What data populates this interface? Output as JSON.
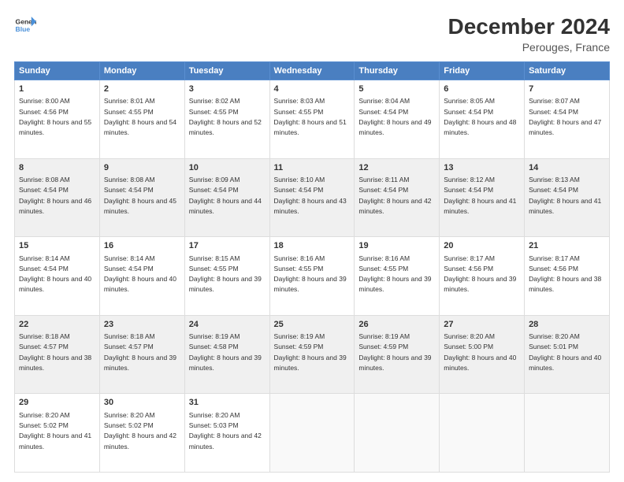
{
  "logo": {
    "line1": "General",
    "line2": "Blue"
  },
  "title": "December 2024",
  "subtitle": "Perouges, France",
  "headers": [
    "Sunday",
    "Monday",
    "Tuesday",
    "Wednesday",
    "Thursday",
    "Friday",
    "Saturday"
  ],
  "weeks": [
    [
      {
        "day": "1",
        "sunrise": "Sunrise: 8:00 AM",
        "sunset": "Sunset: 4:56 PM",
        "daylight": "Daylight: 8 hours and 55 minutes."
      },
      {
        "day": "2",
        "sunrise": "Sunrise: 8:01 AM",
        "sunset": "Sunset: 4:55 PM",
        "daylight": "Daylight: 8 hours and 54 minutes."
      },
      {
        "day": "3",
        "sunrise": "Sunrise: 8:02 AM",
        "sunset": "Sunset: 4:55 PM",
        "daylight": "Daylight: 8 hours and 52 minutes."
      },
      {
        "day": "4",
        "sunrise": "Sunrise: 8:03 AM",
        "sunset": "Sunset: 4:55 PM",
        "daylight": "Daylight: 8 hours and 51 minutes."
      },
      {
        "day": "5",
        "sunrise": "Sunrise: 8:04 AM",
        "sunset": "Sunset: 4:54 PM",
        "daylight": "Daylight: 8 hours and 49 minutes."
      },
      {
        "day": "6",
        "sunrise": "Sunrise: 8:05 AM",
        "sunset": "Sunset: 4:54 PM",
        "daylight": "Daylight: 8 hours and 48 minutes."
      },
      {
        "day": "7",
        "sunrise": "Sunrise: 8:07 AM",
        "sunset": "Sunset: 4:54 PM",
        "daylight": "Daylight: 8 hours and 47 minutes."
      }
    ],
    [
      {
        "day": "8",
        "sunrise": "Sunrise: 8:08 AM",
        "sunset": "Sunset: 4:54 PM",
        "daylight": "Daylight: 8 hours and 46 minutes."
      },
      {
        "day": "9",
        "sunrise": "Sunrise: 8:08 AM",
        "sunset": "Sunset: 4:54 PM",
        "daylight": "Daylight: 8 hours and 45 minutes."
      },
      {
        "day": "10",
        "sunrise": "Sunrise: 8:09 AM",
        "sunset": "Sunset: 4:54 PM",
        "daylight": "Daylight: 8 hours and 44 minutes."
      },
      {
        "day": "11",
        "sunrise": "Sunrise: 8:10 AM",
        "sunset": "Sunset: 4:54 PM",
        "daylight": "Daylight: 8 hours and 43 minutes."
      },
      {
        "day": "12",
        "sunrise": "Sunrise: 8:11 AM",
        "sunset": "Sunset: 4:54 PM",
        "daylight": "Daylight: 8 hours and 42 minutes."
      },
      {
        "day": "13",
        "sunrise": "Sunrise: 8:12 AM",
        "sunset": "Sunset: 4:54 PM",
        "daylight": "Daylight: 8 hours and 41 minutes."
      },
      {
        "day": "14",
        "sunrise": "Sunrise: 8:13 AM",
        "sunset": "Sunset: 4:54 PM",
        "daylight": "Daylight: 8 hours and 41 minutes."
      }
    ],
    [
      {
        "day": "15",
        "sunrise": "Sunrise: 8:14 AM",
        "sunset": "Sunset: 4:54 PM",
        "daylight": "Daylight: 8 hours and 40 minutes."
      },
      {
        "day": "16",
        "sunrise": "Sunrise: 8:14 AM",
        "sunset": "Sunset: 4:54 PM",
        "daylight": "Daylight: 8 hours and 40 minutes."
      },
      {
        "day": "17",
        "sunrise": "Sunrise: 8:15 AM",
        "sunset": "Sunset: 4:55 PM",
        "daylight": "Daylight: 8 hours and 39 minutes."
      },
      {
        "day": "18",
        "sunrise": "Sunrise: 8:16 AM",
        "sunset": "Sunset: 4:55 PM",
        "daylight": "Daylight: 8 hours and 39 minutes."
      },
      {
        "day": "19",
        "sunrise": "Sunrise: 8:16 AM",
        "sunset": "Sunset: 4:55 PM",
        "daylight": "Daylight: 8 hours and 39 minutes."
      },
      {
        "day": "20",
        "sunrise": "Sunrise: 8:17 AM",
        "sunset": "Sunset: 4:56 PM",
        "daylight": "Daylight: 8 hours and 39 minutes."
      },
      {
        "day": "21",
        "sunrise": "Sunrise: 8:17 AM",
        "sunset": "Sunset: 4:56 PM",
        "daylight": "Daylight: 8 hours and 38 minutes."
      }
    ],
    [
      {
        "day": "22",
        "sunrise": "Sunrise: 8:18 AM",
        "sunset": "Sunset: 4:57 PM",
        "daylight": "Daylight: 8 hours and 38 minutes."
      },
      {
        "day": "23",
        "sunrise": "Sunrise: 8:18 AM",
        "sunset": "Sunset: 4:57 PM",
        "daylight": "Daylight: 8 hours and 39 minutes."
      },
      {
        "day": "24",
        "sunrise": "Sunrise: 8:19 AM",
        "sunset": "Sunset: 4:58 PM",
        "daylight": "Daylight: 8 hours and 39 minutes."
      },
      {
        "day": "25",
        "sunrise": "Sunrise: 8:19 AM",
        "sunset": "Sunset: 4:59 PM",
        "daylight": "Daylight: 8 hours and 39 minutes."
      },
      {
        "day": "26",
        "sunrise": "Sunrise: 8:19 AM",
        "sunset": "Sunset: 4:59 PM",
        "daylight": "Daylight: 8 hours and 39 minutes."
      },
      {
        "day": "27",
        "sunrise": "Sunrise: 8:20 AM",
        "sunset": "Sunset: 5:00 PM",
        "daylight": "Daylight: 8 hours and 40 minutes."
      },
      {
        "day": "28",
        "sunrise": "Sunrise: 8:20 AM",
        "sunset": "Sunset: 5:01 PM",
        "daylight": "Daylight: 8 hours and 40 minutes."
      }
    ],
    [
      {
        "day": "29",
        "sunrise": "Sunrise: 8:20 AM",
        "sunset": "Sunset: 5:02 PM",
        "daylight": "Daylight: 8 hours and 41 minutes."
      },
      {
        "day": "30",
        "sunrise": "Sunrise: 8:20 AM",
        "sunset": "Sunset: 5:02 PM",
        "daylight": "Daylight: 8 hours and 42 minutes."
      },
      {
        "day": "31",
        "sunrise": "Sunrise: 8:20 AM",
        "sunset": "Sunset: 5:03 PM",
        "daylight": "Daylight: 8 hours and 42 minutes."
      },
      null,
      null,
      null,
      null
    ]
  ]
}
